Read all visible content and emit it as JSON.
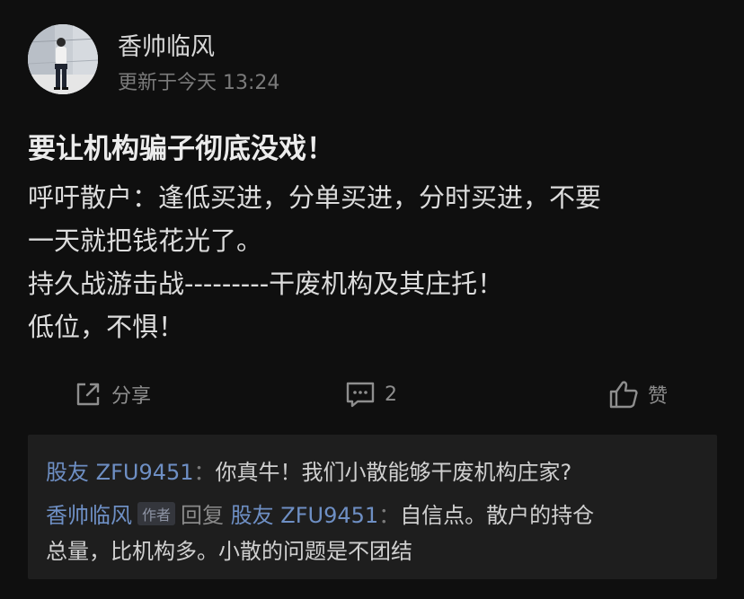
{
  "author": {
    "name": "香帅临风",
    "updated": "更新于今天 13:24",
    "avatar_icon": "user-photo"
  },
  "post": {
    "title": "要让机构骗子彻底没戏！",
    "lines": [
      "呼吁散户：逢低买进，分单买进，分时买进，不要",
      "一天就把钱花光了。",
      "持久战游击战---------干废机构及其庄托！",
      "低位，不惧！"
    ]
  },
  "actions": {
    "share_label": "分享",
    "share_icon": "share-icon",
    "comment_count": "2",
    "comment_icon": "comment-icon",
    "like_label": "赞",
    "like_icon": "thumbs-up-icon"
  },
  "comments": {
    "c1": {
      "user": "股友 ZFU9451",
      "colon": "：",
      "text": "你真牛！我们小散能够干废机构庄家?"
    },
    "c2": {
      "user": "香帅临风",
      "author_tag": "作者",
      "reply_label": "回复",
      "reply_to": "股友 ZFU9451",
      "colon": "：",
      "text_line1": "自信点。散户的持仓",
      "text_line2": "总量，比机构多。小散的问题是不团结"
    }
  },
  "colors": {
    "background": "#0f0f0f",
    "comment_bg": "#1e1e1e",
    "link_blue": "#6e8fc4"
  }
}
